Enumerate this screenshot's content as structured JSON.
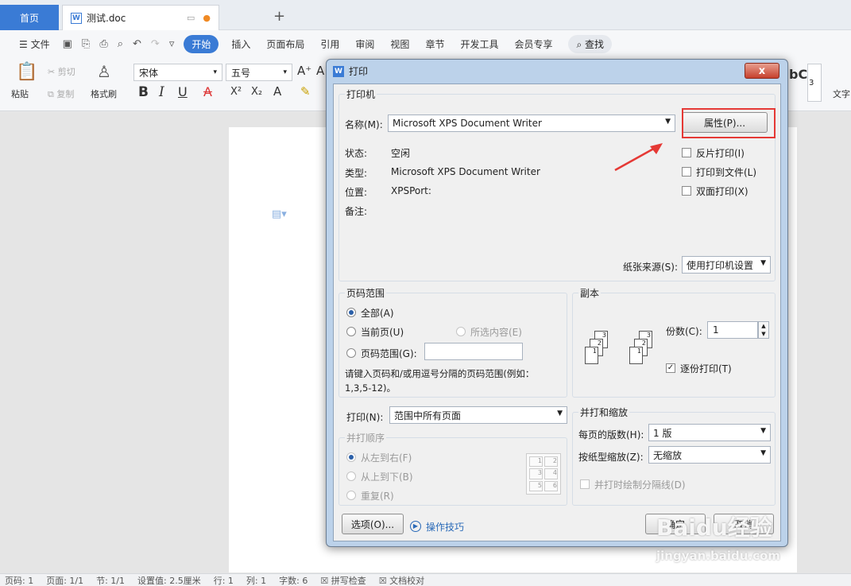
{
  "tabs": {
    "home": "首页",
    "doc": "测试.doc"
  },
  "menu": {
    "file": "文件",
    "start": "开始",
    "insert": "插入",
    "layout": "页面布局",
    "ref": "引用",
    "review": "审阅",
    "view": "视图",
    "chapter": "章节",
    "dev": "开发工具",
    "member": "会员专享",
    "search": "查找"
  },
  "ribbon": {
    "paste": "粘贴",
    "cut": "剪切",
    "copy": "复制",
    "format_painter": "格式刷",
    "font": "宋体",
    "size": "五号",
    "style_sample": "bC",
    "style_num": "3",
    "text_tool": "文字"
  },
  "status": {
    "pages": "页码: 1",
    "page": "页面: 1/1",
    "section": "节: 1/1",
    "setting": "设置值: 2.5厘米",
    "row": "行: 1",
    "col": "列: 1",
    "words": "字数: 6",
    "spell": "拼写检查",
    "proof": "文档校对"
  },
  "dialog": {
    "title": "打印",
    "close": "x",
    "printer": {
      "group": "打印机",
      "name_label": "名称(M):",
      "name_value": "Microsoft XPS Document Writer",
      "properties": "属性(P)...",
      "status_label": "状态:",
      "status_value": "空闲",
      "type_label": "类型:",
      "type_value": "Microsoft XPS Document Writer",
      "location_label": "位置:",
      "location_value": "XPSPort:",
      "comment_label": "备注:",
      "reverse": "反片打印(I)",
      "to_file": "打印到文件(L)",
      "duplex": "双面打印(X)",
      "source_label": "纸张来源(S):",
      "source_value": "使用打印机设置"
    },
    "range": {
      "group": "页码范围",
      "all": "全部(A)",
      "current": "当前页(U)",
      "selection": "所选内容(E)",
      "pages": "页码范围(G):",
      "hint": "请键入页码和/或用逗号分隔的页码范围(例如：",
      "hint2": "1,3,5-12)。"
    },
    "copies": {
      "group": "副本",
      "count_label": "份数(C):",
      "count_value": "1",
      "collate": "逐份打印(T)"
    },
    "print_what": {
      "label": "打印(N):",
      "value": "范围中所有页面"
    },
    "order": {
      "group": "并打顺序",
      "ltr": "从左到右(F)",
      "ttb": "从上到下(B)",
      "repeat": "重复(R)"
    },
    "zoom": {
      "group": "并打和缩放",
      "per_page_label": "每页的版数(H):",
      "per_page_value": "1 版",
      "scale_label": "按纸型缩放(Z):",
      "scale_value": "无缩放",
      "lines": "并打时绘制分隔线(D)"
    },
    "buttons": {
      "options": "选项(O)...",
      "tips": "操作技巧",
      "ok": "确定",
      "cancel": "取消"
    }
  },
  "watermark": {
    "brand": "Baidu经验",
    "url": "jingyan.baidu.com"
  }
}
